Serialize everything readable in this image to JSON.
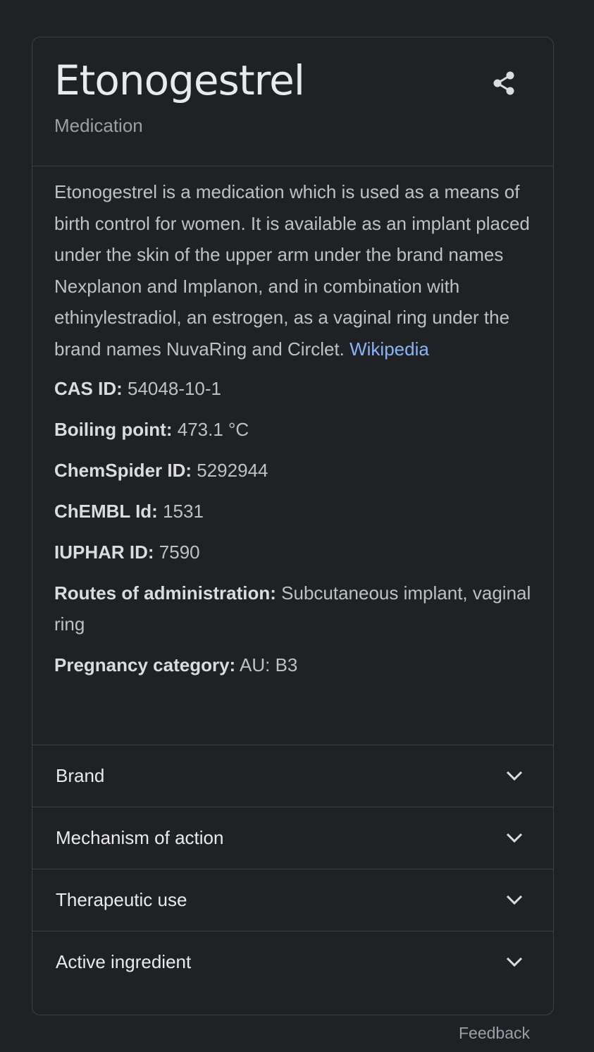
{
  "header": {
    "title": "Etonogestrel",
    "subtitle": "Medication",
    "share_icon": "share-icon"
  },
  "description": {
    "text": "Etonogestrel is a medication which is used as a means of birth control for women. It is available as an implant placed under the skin of the upper arm under the brand names Nexplanon and Implanon, and in combination with ethinylestradiol, an estrogen, as a vaginal ring under the brand names NuvaRing and Circlet.",
    "source_link": "Wikipedia"
  },
  "facts": [
    {
      "key": "CAS ID:",
      "value": "54048-10-1"
    },
    {
      "key": "Boiling point:",
      "value": "473.1 °C"
    },
    {
      "key": "ChemSpider ID:",
      "value": "5292944"
    },
    {
      "key": "ChEMBL Id:",
      "value": "1531"
    },
    {
      "key": "IUPHAR ID:",
      "value": "7590"
    },
    {
      "key": "Routes of administration:",
      "value": "Subcutaneous implant, vaginal ring"
    },
    {
      "key": "Pregnancy category:",
      "value": "AU: B3"
    }
  ],
  "sections": [
    {
      "label": "Brand",
      "icon": "chevron-down-icon"
    },
    {
      "label": "Mechanism of action",
      "icon": "chevron-down-icon"
    },
    {
      "label": "Therapeutic use",
      "icon": "chevron-down-icon"
    },
    {
      "label": "Active ingredient",
      "icon": "chevron-down-icon"
    }
  ],
  "footer": {
    "feedback": "Feedback"
  },
  "colors": {
    "background": "#202124",
    "border": "#3c4043",
    "link": "#8ab4f8",
    "title": "#e8eaed"
  }
}
